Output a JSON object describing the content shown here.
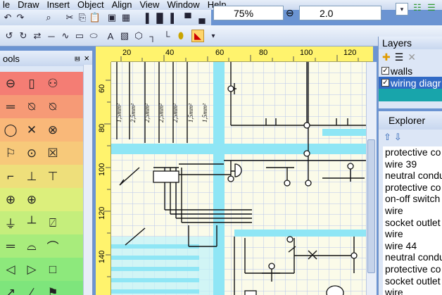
{
  "menu": [
    "le",
    "Draw",
    "Insert",
    "Object",
    "Align",
    "View",
    "Window",
    "Help"
  ],
  "toolbar": {
    "zoom_value": "75%",
    "line_width": "2.0"
  },
  "tools_panel": {
    "title": "ools",
    "pin": "⩏",
    "close": "×"
  },
  "ruler": {
    "h_ticks": [
      "20",
      "40",
      "60",
      "80",
      "100",
      "120"
    ],
    "v_ticks": [
      "60",
      "80",
      "100",
      "120",
      "140"
    ]
  },
  "drawing": {
    "wire_labels": [
      "1,5mm²",
      "2,5mm²",
      "2,5mm²",
      "2,5mm²",
      "2,5mm²",
      "1,5mm²",
      "1,5mm²"
    ]
  },
  "layers": {
    "title": "Layers",
    "items": [
      {
        "label": "walls",
        "checked": true,
        "selected": false
      },
      {
        "label": "wiring diagr",
        "checked": true,
        "selected": true
      }
    ]
  },
  "explorer": {
    "title": "Explorer",
    "items": [
      "protective co",
      "wire 39",
      "neutral condu",
      "protective co",
      "on-off switch",
      "wire",
      "socket outlet",
      "wire",
      "wire 44",
      "neutral condu",
      "protective co",
      "socket outlet",
      "wire"
    ]
  },
  "colors": {
    "accent": "#316ac5",
    "ruler": "#fff36d",
    "room_fill": "#8fe6f5",
    "layers_fill": "#18a5ab"
  }
}
